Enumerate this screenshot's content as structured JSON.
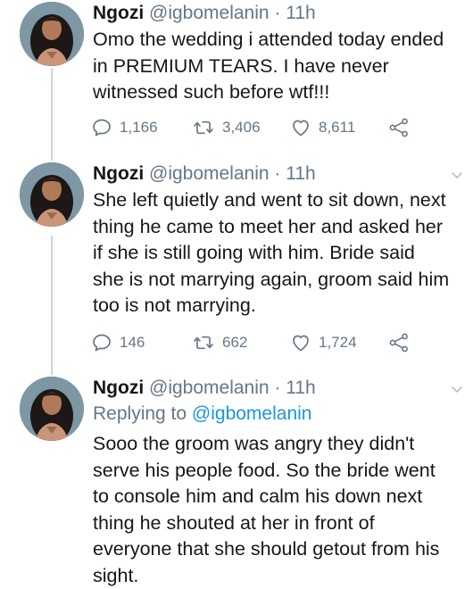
{
  "tweets": [
    {
      "author_name": "Ngozi",
      "handle": "@igbomelanin",
      "separator": "·",
      "time": "11h",
      "text_lines": [
        "Omo the wedding i attended today ended",
        "in PREMIUM TEARS. I have never",
        "witnessed such before wtf!!!"
      ],
      "replies": "1,166",
      "retweets": "3,406",
      "likes": "8,611"
    },
    {
      "author_name": "Ngozi",
      "handle": "@igbomelanin",
      "separator": "·",
      "time": "11h",
      "text_lines": [
        "She left quietly and went to sit down, next",
        "thing he came to meet her and asked her",
        "if she is still going with him. Bride said",
        "she is not marrying again, groom said him",
        "too is not marrying."
      ],
      "replies": "146",
      "retweets": "662",
      "likes": "1,724"
    },
    {
      "author_name": "Ngozi",
      "handle": "@igbomelanin",
      "separator": "·",
      "time": "11h",
      "replying_prefix": "Replying to",
      "replying_handle": "@igbomelanin",
      "text_lines": [
        "Sooo the groom was angry they didn't",
        "serve his people food. So the bride went",
        "to console him and calm his down next",
        "thing he shouted at her in front of",
        "everyone that she should getout from his",
        "sight."
      ]
    }
  ],
  "icons": {
    "reply": "reply-icon",
    "retweet": "retweet-icon",
    "like": "heart-icon",
    "share": "share-icon",
    "caret": "chevron-down-icon"
  },
  "colors": {
    "text": "#14171a",
    "muted": "#657786",
    "link": "#1b95e0",
    "thread_line": "#ccd6dd",
    "divider": "#e6ecf0"
  }
}
